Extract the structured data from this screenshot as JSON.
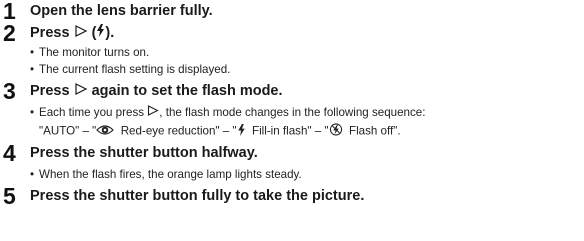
{
  "steps": [
    {
      "number": "1",
      "text": "Open the lens barrier fully.",
      "bullets": []
    },
    {
      "number": "2",
      "text_prefix": "Press",
      "text_suffix": ").",
      "open_paren": "(",
      "bullets": [
        "The monitor turns on.",
        "The current flash setting is displayed."
      ]
    },
    {
      "number": "3",
      "text_prefix": "Press",
      "text_suffix": "again to set the flash mode.",
      "bullet_line1_a": "Each time you press",
      "bullet_line1_b": ", the flash mode changes in the following sequence:",
      "seq_auto": "\"AUTO\" – \"",
      "seq_red": "Red-eye reduction\" – \"",
      "seq_fill": "Fill-in flash\" – \"",
      "seq_off": "Flash off\"."
    },
    {
      "number": "4",
      "text": "Press the shutter button halfway.",
      "bullets": [
        "When the flash fires, the orange lamp lights steady."
      ]
    },
    {
      "number": "5",
      "text": "Press the shutter button fully to take the picture.",
      "bullets": []
    }
  ],
  "icons": {
    "right_triangle": "right-triangle-icon",
    "flash": "flash-icon",
    "red_eye": "red-eye-icon",
    "flash_off": "flash-off-icon"
  }
}
